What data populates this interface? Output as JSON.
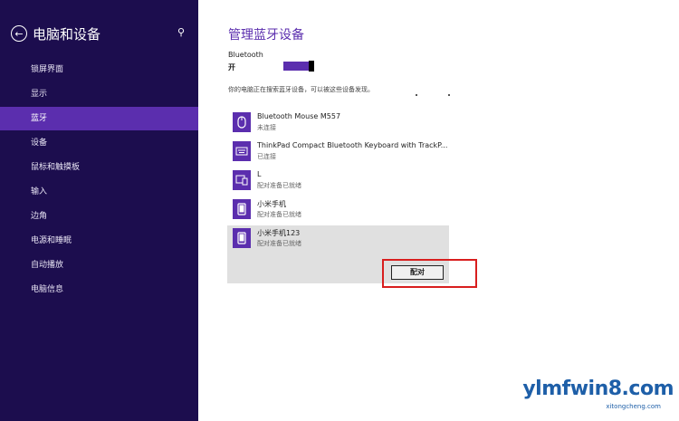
{
  "sidebar": {
    "title": "电脑和设备",
    "items": [
      {
        "label": "锁屏界面"
      },
      {
        "label": "显示"
      },
      {
        "label": "蓝牙"
      },
      {
        "label": "设备"
      },
      {
        "label": "鼠标和触摸板"
      },
      {
        "label": "输入"
      },
      {
        "label": "边角"
      },
      {
        "label": "电源和睡眠"
      },
      {
        "label": "自动播放"
      },
      {
        "label": "电脑信息"
      }
    ],
    "active_index": 2
  },
  "main": {
    "title": "管理蓝牙设备",
    "bluetooth_label": "Bluetooth",
    "bluetooth_state": "开",
    "bluetooth_on": true,
    "hint": "你的电脑正在搜索蓝牙设备，可以被这些设备发现。",
    "devices": [
      {
        "name": "Bluetooth Mouse M557",
        "status": "未连接",
        "icon": "mouse-icon"
      },
      {
        "name": "ThinkPad Compact Bluetooth Keyboard with TrackP...",
        "status": "已连接",
        "icon": "keyboard-icon"
      },
      {
        "name": "L",
        "status": "配对准备已就绪",
        "icon": "devices-icon"
      },
      {
        "name": "小米手机",
        "status": "配对准备已就绪",
        "icon": "phone-icon"
      },
      {
        "name": "小米手机123",
        "status": "配对准备已就绪",
        "icon": "phone-icon"
      }
    ],
    "pair_button": "配对"
  },
  "watermark": {
    "main": "ylmfwin8.com",
    "sub": "xitongcheng.com"
  },
  "colors": {
    "sidebar_bg": "#1c0d4e",
    "accent": "#5b2eae",
    "highlight": "#d81e1e"
  }
}
